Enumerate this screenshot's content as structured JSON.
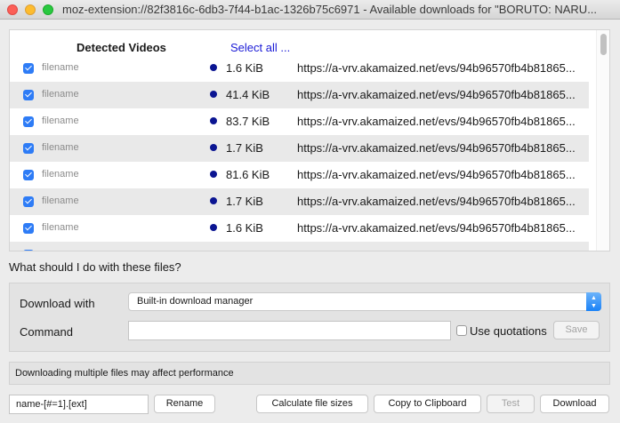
{
  "window": {
    "title": "moz-extension://82f3816c-6db3-7f44-b1ac-1326b75c6971 - Available downloads for \"BORUTO: NARU..."
  },
  "list": {
    "header_detected": "Detected Videos",
    "header_select_all": "Select all ...",
    "rows": [
      {
        "checked": true,
        "filename": "filename",
        "size": "1.6 KiB",
        "url": "https://a-vrv.akamaized.net/evs/94b96570fb4b81865..."
      },
      {
        "checked": true,
        "filename": "filename",
        "size": "41.4 KiB",
        "url": "https://a-vrv.akamaized.net/evs/94b96570fb4b81865..."
      },
      {
        "checked": true,
        "filename": "filename",
        "size": "83.7 KiB",
        "url": "https://a-vrv.akamaized.net/evs/94b96570fb4b81865..."
      },
      {
        "checked": true,
        "filename": "filename",
        "size": "1.7 KiB",
        "url": "https://a-vrv.akamaized.net/evs/94b96570fb4b81865..."
      },
      {
        "checked": true,
        "filename": "filename",
        "size": "81.6 KiB",
        "url": "https://a-vrv.akamaized.net/evs/94b96570fb4b81865..."
      },
      {
        "checked": true,
        "filename": "filename",
        "size": "1.7 KiB",
        "url": "https://a-vrv.akamaized.net/evs/94b96570fb4b81865..."
      },
      {
        "checked": true,
        "filename": "filename",
        "size": "1.6 KiB",
        "url": "https://a-vrv.akamaized.net/evs/94b96570fb4b81865..."
      }
    ]
  },
  "question": "What should I do with these files?",
  "options": {
    "download_with_label": "Download with",
    "download_with_value": "Built-in download manager",
    "command_label": "Command",
    "command_value": "",
    "use_quotations_label": "Use quotations",
    "save_label": "Save"
  },
  "warning": "Downloading multiple files may affect performance",
  "footer": {
    "name_pattern": "name-[#=1].[ext]",
    "rename_label": "Rename",
    "calculate_label": "Calculate file sizes",
    "copy_label": "Copy to Clipboard",
    "test_label": "Test",
    "download_label": "Download"
  },
  "colors": {
    "checkbox_accent": "#2e7cf6",
    "status_dot": "#0b1592",
    "select_all_link": "#1a1ad6"
  },
  "icons": {
    "checkbox": "checkmark-icon",
    "status": "status-dot-icon",
    "select_arrow": "updown-chevron-icon"
  }
}
